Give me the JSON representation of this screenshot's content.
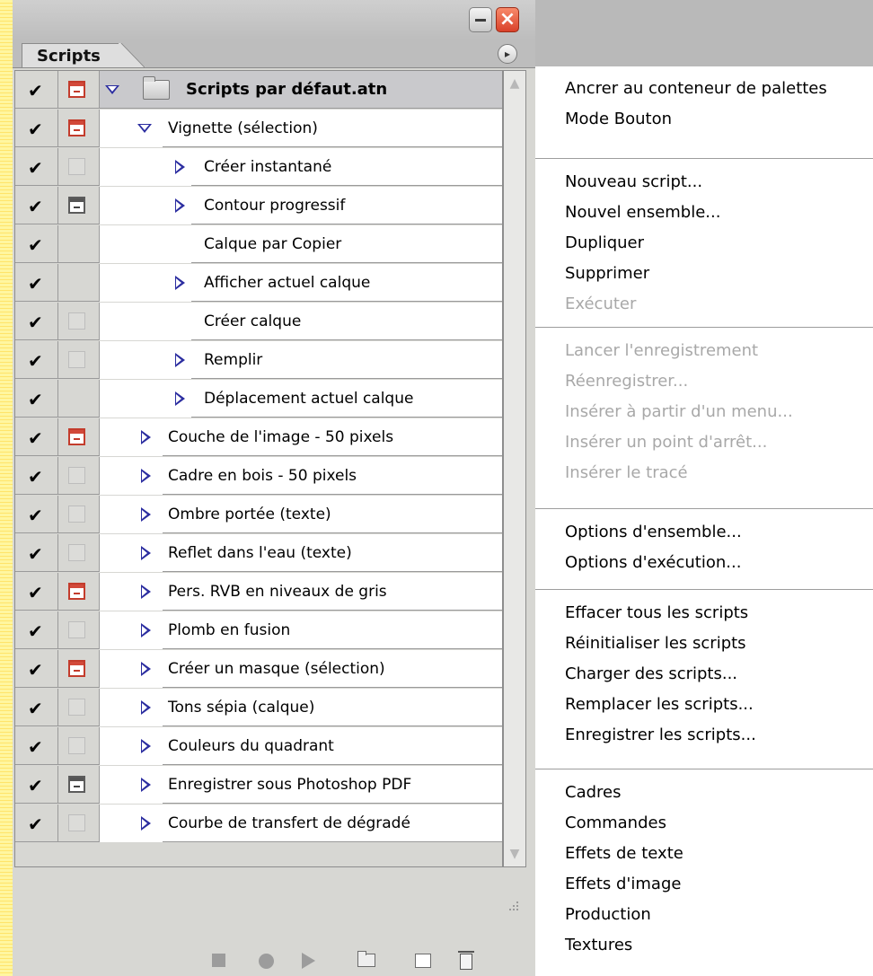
{
  "palette": {
    "tab_label": "Scripts",
    "colors": {
      "header_row": "#c9c9cc",
      "triangle": "#2b2da0",
      "dialog_red": "#c33c2c"
    },
    "rows": [
      {
        "check": "✔",
        "dialog": "red",
        "kind": "set",
        "label": "Scripts par défaut.atn"
      },
      {
        "check": "✔",
        "dialog": "red",
        "kind": "action",
        "expanded": true,
        "label": "Vignette (sélection)"
      },
      {
        "check": "✔",
        "dialog": "faint",
        "kind": "step",
        "expandable": true,
        "label": "Créer instantané"
      },
      {
        "check": "✔",
        "dialog": "gray",
        "kind": "step",
        "expandable": true,
        "label": "Contour progressif"
      },
      {
        "check": "✔",
        "dialog": "none",
        "kind": "step",
        "expandable": false,
        "label": "Calque par Copier"
      },
      {
        "check": "✔",
        "dialog": "none",
        "kind": "step",
        "expandable": true,
        "label": "Afficher actuel calque"
      },
      {
        "check": "✔",
        "dialog": "faint",
        "kind": "step",
        "expandable": false,
        "label": "Créer calque"
      },
      {
        "check": "✔",
        "dialog": "faint",
        "kind": "step",
        "expandable": true,
        "label": "Remplir"
      },
      {
        "check": "✔",
        "dialog": "none",
        "kind": "step",
        "expandable": true,
        "label": "Déplacement actuel calque"
      },
      {
        "check": "✔",
        "dialog": "red",
        "kind": "action",
        "label": "Couche de l'image - 50 pixels"
      },
      {
        "check": "✔",
        "dialog": "faint",
        "kind": "action",
        "label": "Cadre en bois - 50 pixels"
      },
      {
        "check": "✔",
        "dialog": "faint",
        "kind": "action",
        "label": "Ombre portée (texte)"
      },
      {
        "check": "✔",
        "dialog": "faint",
        "kind": "action",
        "label": "Reflet dans l'eau (texte)"
      },
      {
        "check": "✔",
        "dialog": "red",
        "kind": "action",
        "label": "Pers. RVB en niveaux de gris"
      },
      {
        "check": "✔",
        "dialog": "faint",
        "kind": "action",
        "label": "Plomb en fusion"
      },
      {
        "check": "✔",
        "dialog": "red",
        "kind": "action",
        "label": "Créer un masque (sélection)"
      },
      {
        "check": "✔",
        "dialog": "faint",
        "kind": "action",
        "label": "Tons sépia (calque)"
      },
      {
        "check": "✔",
        "dialog": "faint",
        "kind": "action",
        "label": "Couleurs du quadrant"
      },
      {
        "check": "✔",
        "dialog": "gray",
        "kind": "action",
        "label": "Enregistrer sous Photoshop PDF"
      },
      {
        "check": "✔",
        "dialog": "faint",
        "kind": "action",
        "label": "Courbe de transfert de dégradé"
      }
    ],
    "toolbar_icons": [
      "stop-icon",
      "record-icon",
      "play-icon",
      "new-set-icon",
      "new-script-icon",
      "trash-icon"
    ]
  },
  "menu": {
    "groups": [
      [
        {
          "label": "Ancrer au conteneur de palettes",
          "enabled": true
        },
        {
          "label": "Mode Bouton",
          "enabled": true
        }
      ],
      [
        {
          "label": "Nouveau script...",
          "enabled": true
        },
        {
          "label": "Nouvel ensemble...",
          "enabled": true
        },
        {
          "label": "Dupliquer",
          "enabled": true
        },
        {
          "label": "Supprimer",
          "enabled": true
        },
        {
          "label": "Exécuter",
          "enabled": false
        }
      ],
      [
        {
          "label": "Lancer l'enregistrement",
          "enabled": false
        },
        {
          "label": "Réenregistrer...",
          "enabled": false
        },
        {
          "label": "Insérer à partir d'un menu...",
          "enabled": false
        },
        {
          "label": "Insérer un point d'arrêt...",
          "enabled": false
        },
        {
          "label": "Insérer le tracé",
          "enabled": false
        }
      ],
      [
        {
          "label": "Options d'ensemble...",
          "enabled": true
        },
        {
          "label": "Options d'exécution...",
          "enabled": true
        }
      ],
      [
        {
          "label": "Effacer tous les scripts",
          "enabled": true
        },
        {
          "label": "Réinitialiser les scripts",
          "enabled": true
        },
        {
          "label": "Charger des scripts...",
          "enabled": true
        },
        {
          "label": "Remplacer les scripts...",
          "enabled": true
        },
        {
          "label": "Enregistrer les scripts...",
          "enabled": true
        }
      ],
      [
        {
          "label": "Cadres",
          "enabled": true
        },
        {
          "label": "Commandes",
          "enabled": true
        },
        {
          "label": "Effets de texte",
          "enabled": true
        },
        {
          "label": "Effets d'image",
          "enabled": true
        },
        {
          "label": "Production",
          "enabled": true
        },
        {
          "label": "Textures",
          "enabled": true
        }
      ]
    ]
  }
}
